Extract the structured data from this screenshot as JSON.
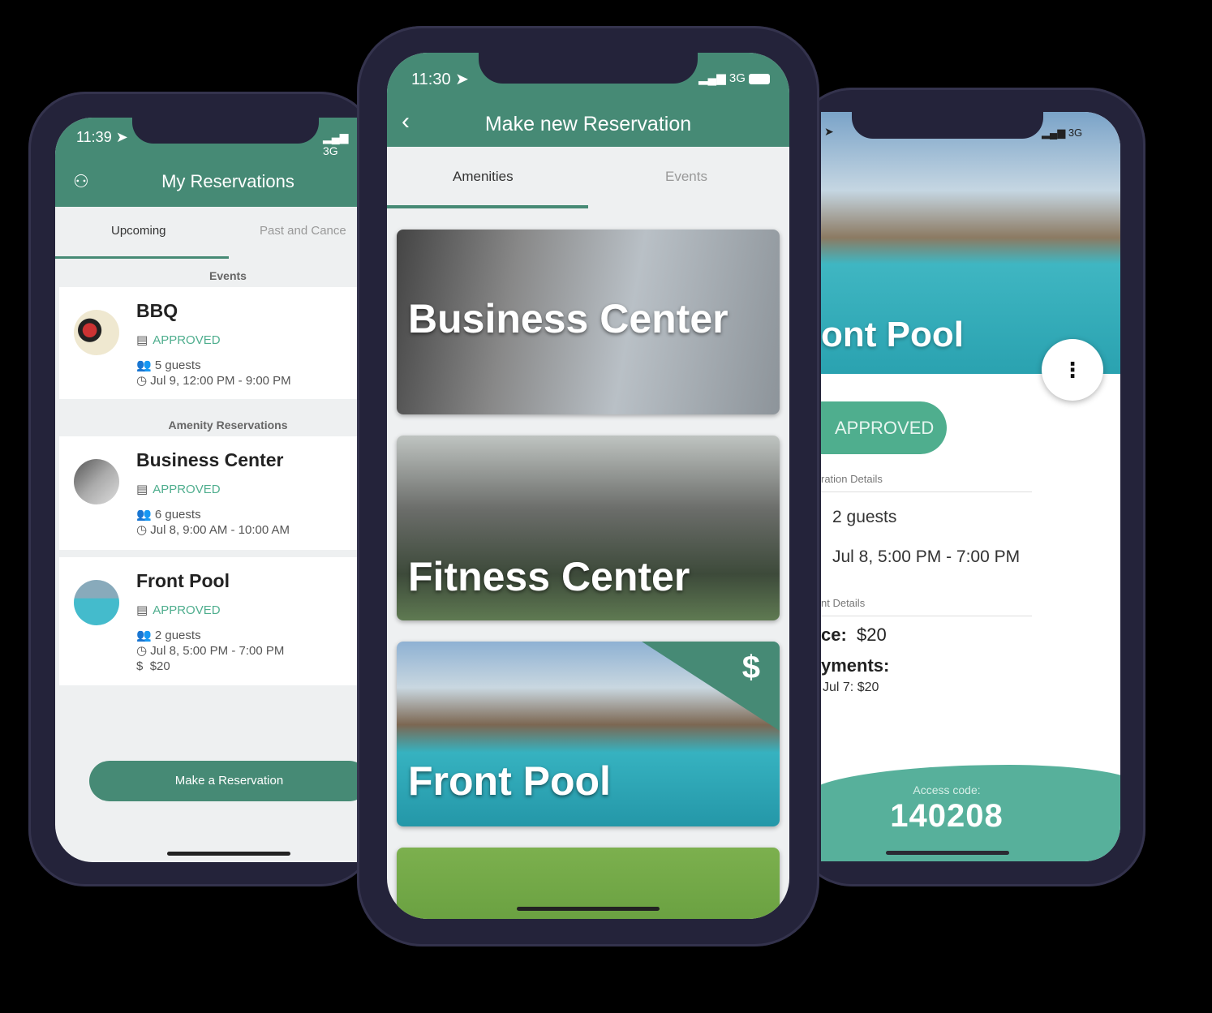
{
  "left_phone": {
    "status_time": "11:39",
    "status_network": "3G",
    "title": "My Reservations",
    "tabs": [
      "Upcoming",
      "Past and Cance"
    ],
    "events_header": "Events",
    "amenity_header": "Amenity Reservations",
    "reservations": [
      {
        "title": "BBQ",
        "status": "APPROVED",
        "guests": "5 guests",
        "time": "Jul 9, 12:00 PM - 9:00 PM",
        "avatar_text": "BBQ"
      },
      {
        "title": "Business Center",
        "status": "APPROVED",
        "guests": "6 guests",
        "time": "Jul 8, 9:00 AM - 10:00 AM"
      },
      {
        "title": "Front Pool",
        "status": "APPROVED",
        "guests": "2 guests",
        "time": "Jul 8, 5:00 PM - 7:00 PM",
        "price": "$20"
      }
    ],
    "make_button": "Make a Reservation"
  },
  "center_phone": {
    "status_time": "11:30",
    "status_network": "3G",
    "title": "Make new Reservation",
    "tabs": [
      "Amenities",
      "Events"
    ],
    "amenities": [
      {
        "name": "Business Center"
      },
      {
        "name": "Fitness Center"
      },
      {
        "name": "Front Pool",
        "paid_badge": "$"
      },
      {
        "name": ""
      }
    ]
  },
  "right_phone": {
    "status_network": "3G",
    "title": "ont Pool",
    "status": "APPROVED",
    "reservation_details_label": "ration Details",
    "guests": "2 guests",
    "time": "Jul 8, 5:00 PM - 7:00 PM",
    "payment_details_label": "nt Details",
    "price_label": "ce:",
    "price_value": "$20",
    "payments_label": "yments:",
    "payment_entry": "Jul 7: $20",
    "access_code_label": "Access code:",
    "access_code": "140208"
  },
  "colors": {
    "primary": "#468a75",
    "approved": "#4fae8e",
    "access_bg": "#57b09b",
    "frame": "#24233a"
  }
}
